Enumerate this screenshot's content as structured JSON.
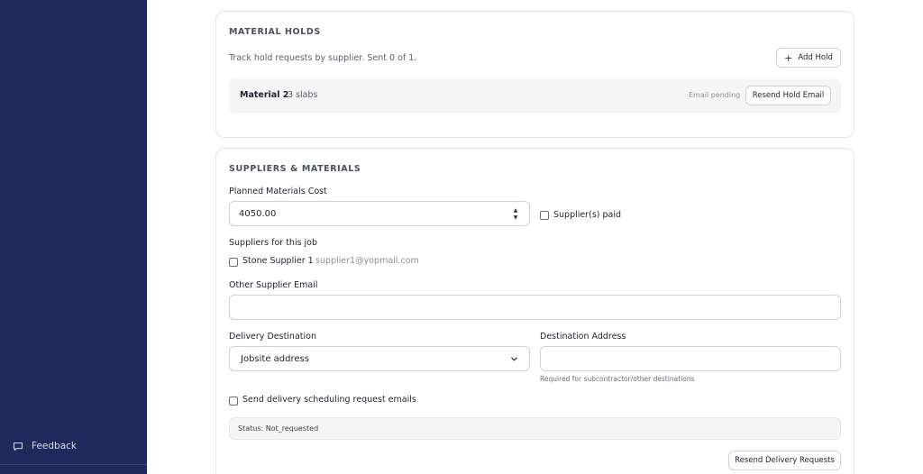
{
  "sidebar": {
    "feedback_label": "Feedback"
  },
  "holds": {
    "title": "MATERIAL HOLDS",
    "description": "Track hold requests by supplier. Sent 0 of 1.",
    "add_hold_label": "Add Hold",
    "items": [
      {
        "material": "Material 2",
        "quantity": "3 slabs",
        "status": "Email pending",
        "resend_label": "Resend Hold Email"
      }
    ]
  },
  "suppliers": {
    "title": "SUPPLIERS & MATERIALS",
    "planned_cost_label": "Planned Materials Cost",
    "planned_cost_value": "4050.00",
    "suppliers_paid_label": "Supplier(s) paid",
    "suppliers_paid_checked": false,
    "suppliers_for_job_label": "Suppliers for this job",
    "supplier_list": [
      {
        "name": "Stone Supplier 1",
        "email": "supplier1@yopmail.com",
        "checked": false
      }
    ],
    "other_email_label": "Other Supplier Email",
    "other_email_value": "",
    "delivery_destination_label": "Delivery Destination",
    "delivery_destination_value": "Jobsite address",
    "destination_address_label": "Destination Address",
    "destination_address_value": "",
    "destination_address_helper": "Required for subcontractor/other destinations",
    "send_scheduling_label": "Send delivery scheduling request emails",
    "send_scheduling_checked": false,
    "status_text": "Status: Not_requested",
    "resend_delivery_label": "Resend Delivery Requests"
  },
  "colors": {
    "sidebar_bg": "#1f2a5c",
    "page_bg": "#ffffff",
    "border": "#e4e4e7"
  }
}
